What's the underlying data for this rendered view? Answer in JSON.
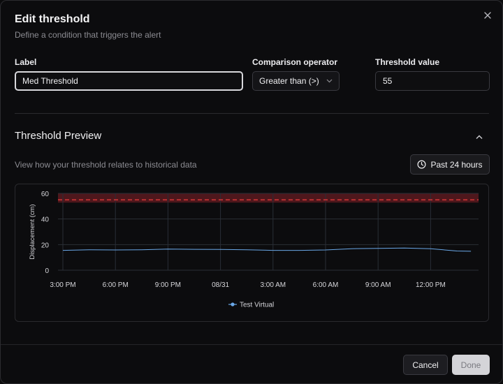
{
  "dialog": {
    "title": "Edit threshold",
    "subtitle": "Define a condition that triggers the alert",
    "close_icon": "close-icon"
  },
  "form": {
    "label_title": "Label",
    "label_value": "Med Threshold",
    "operator_title": "Comparison operator",
    "operator_value": "Greater than (>)",
    "threshold_title": "Threshold value",
    "threshold_value": "55"
  },
  "preview": {
    "title": "Threshold Preview",
    "description": "View how your threshold relates to historical data",
    "range_label": "Past 24 hours",
    "range_icon": "clock-icon",
    "collapse_icon": "chevron-up-icon"
  },
  "chart_data": {
    "type": "line",
    "ylabel": "Displacement (cm)",
    "xlabel": "",
    "ylim": [
      0,
      60
    ],
    "yticks": [
      0,
      20,
      40,
      60
    ],
    "xticks": [
      "3:00 PM",
      "6:00 PM",
      "9:00 PM",
      "08/31",
      "3:00 AM",
      "6:00 AM",
      "9:00 AM",
      "12:00 PM"
    ],
    "grid": true,
    "legend_position": "bottom",
    "threshold": {
      "value": 55,
      "operator": ">",
      "color": "#e03a3a",
      "band_color": "#5a1a1f"
    },
    "series": [
      {
        "name": "Test Virtual",
        "color": "#6aa8e8",
        "x_hours": [
          0,
          1.5,
          3,
          4.5,
          6,
          7.5,
          9,
          10.5,
          12,
          13.5,
          15,
          16.5,
          18,
          19.5,
          21,
          22.5,
          23.3
        ],
        "values": [
          15.5,
          16,
          15.8,
          16,
          16.5,
          16.3,
          16.2,
          16,
          15.5,
          15.5,
          15.8,
          16.8,
          17,
          17.3,
          16.8,
          15,
          14.8
        ]
      }
    ]
  },
  "footer": {
    "cancel_label": "Cancel",
    "done_label": "Done"
  },
  "colors": {
    "background": "#0c0c0e",
    "accent_line": "#6aa8e8",
    "threshold_line": "#e03a3a"
  }
}
